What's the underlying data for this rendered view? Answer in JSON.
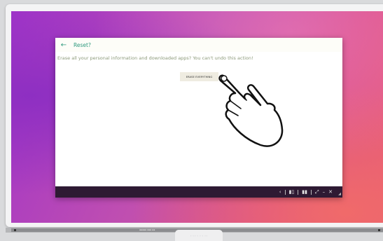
{
  "dialog": {
    "title": "Reset?",
    "message": "Erase all your personal information and downloaded apps? You can't undo this action!",
    "erase_button": "ERASE EVERYTHING"
  },
  "taskbar": {
    "back": "‹",
    "apps_icon": "▮▯",
    "windows_icon": "▮▮",
    "expand": "⤢",
    "minimize": "–",
    "close": "✕"
  },
  "device": {
    "ledge_label": "▪▪▪▪▪ ▪▪▪ ▪▪",
    "controls": "◦ ◦◦ ◦ ◦ ◦ ◦◦"
  },
  "colors": {
    "accent": "#2f9a7e",
    "taskbar": "#2e1a33",
    "button_bg": "#efece1"
  }
}
